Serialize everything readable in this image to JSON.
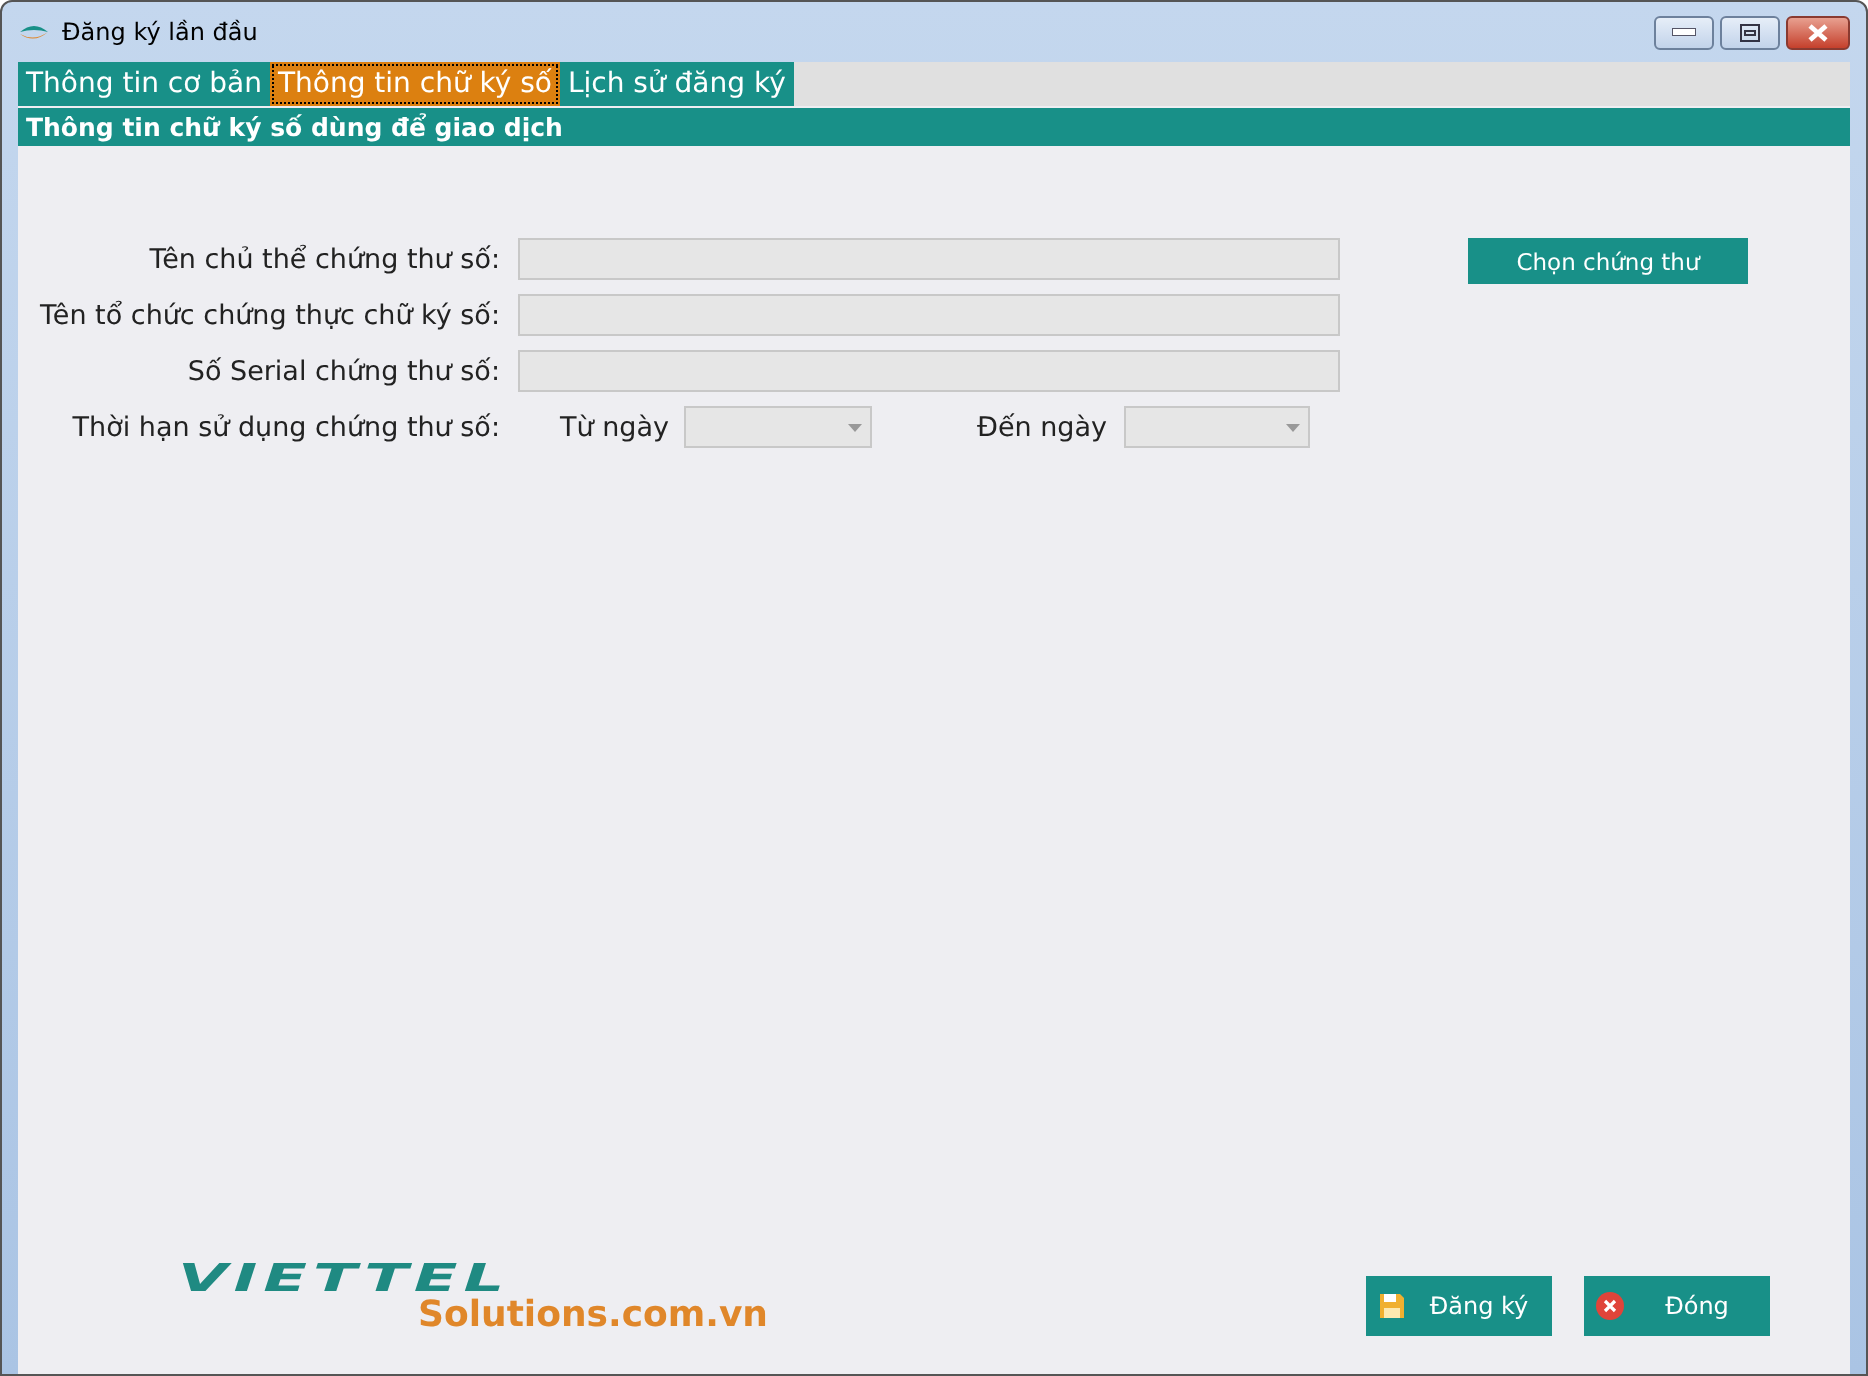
{
  "window": {
    "title": "Đăng ký lần đầu"
  },
  "tabs": [
    {
      "label": "Thông tin cơ bản",
      "selected": false
    },
    {
      "label": "Thông tin chữ ký số",
      "selected": true
    },
    {
      "label": "Lịch sử đăng ký",
      "selected": false
    }
  ],
  "section": {
    "title": "Thông tin chữ ký số dùng để giao dịch"
  },
  "fields": [
    {
      "label": "Tên chủ thể chứng thư số:"
    },
    {
      "label": "Tên tổ chức chứng thực chữ ký số:"
    },
    {
      "label": "Số Serial chứng thư số:"
    }
  ],
  "validity": {
    "label": "Thời hạn sử dụng chứng thư số:",
    "from_label": "Từ ngày",
    "to_label": "Đến ngày"
  },
  "choose_button": "Chọn chứng thư",
  "logo": {
    "wordmark": "VIETTEL",
    "tagline": "Solutions.com.vn"
  },
  "buttons": [
    {
      "kind": "save",
      "label": "Đăng ký"
    },
    {
      "kind": "close",
      "label": "Đóng"
    }
  ]
}
